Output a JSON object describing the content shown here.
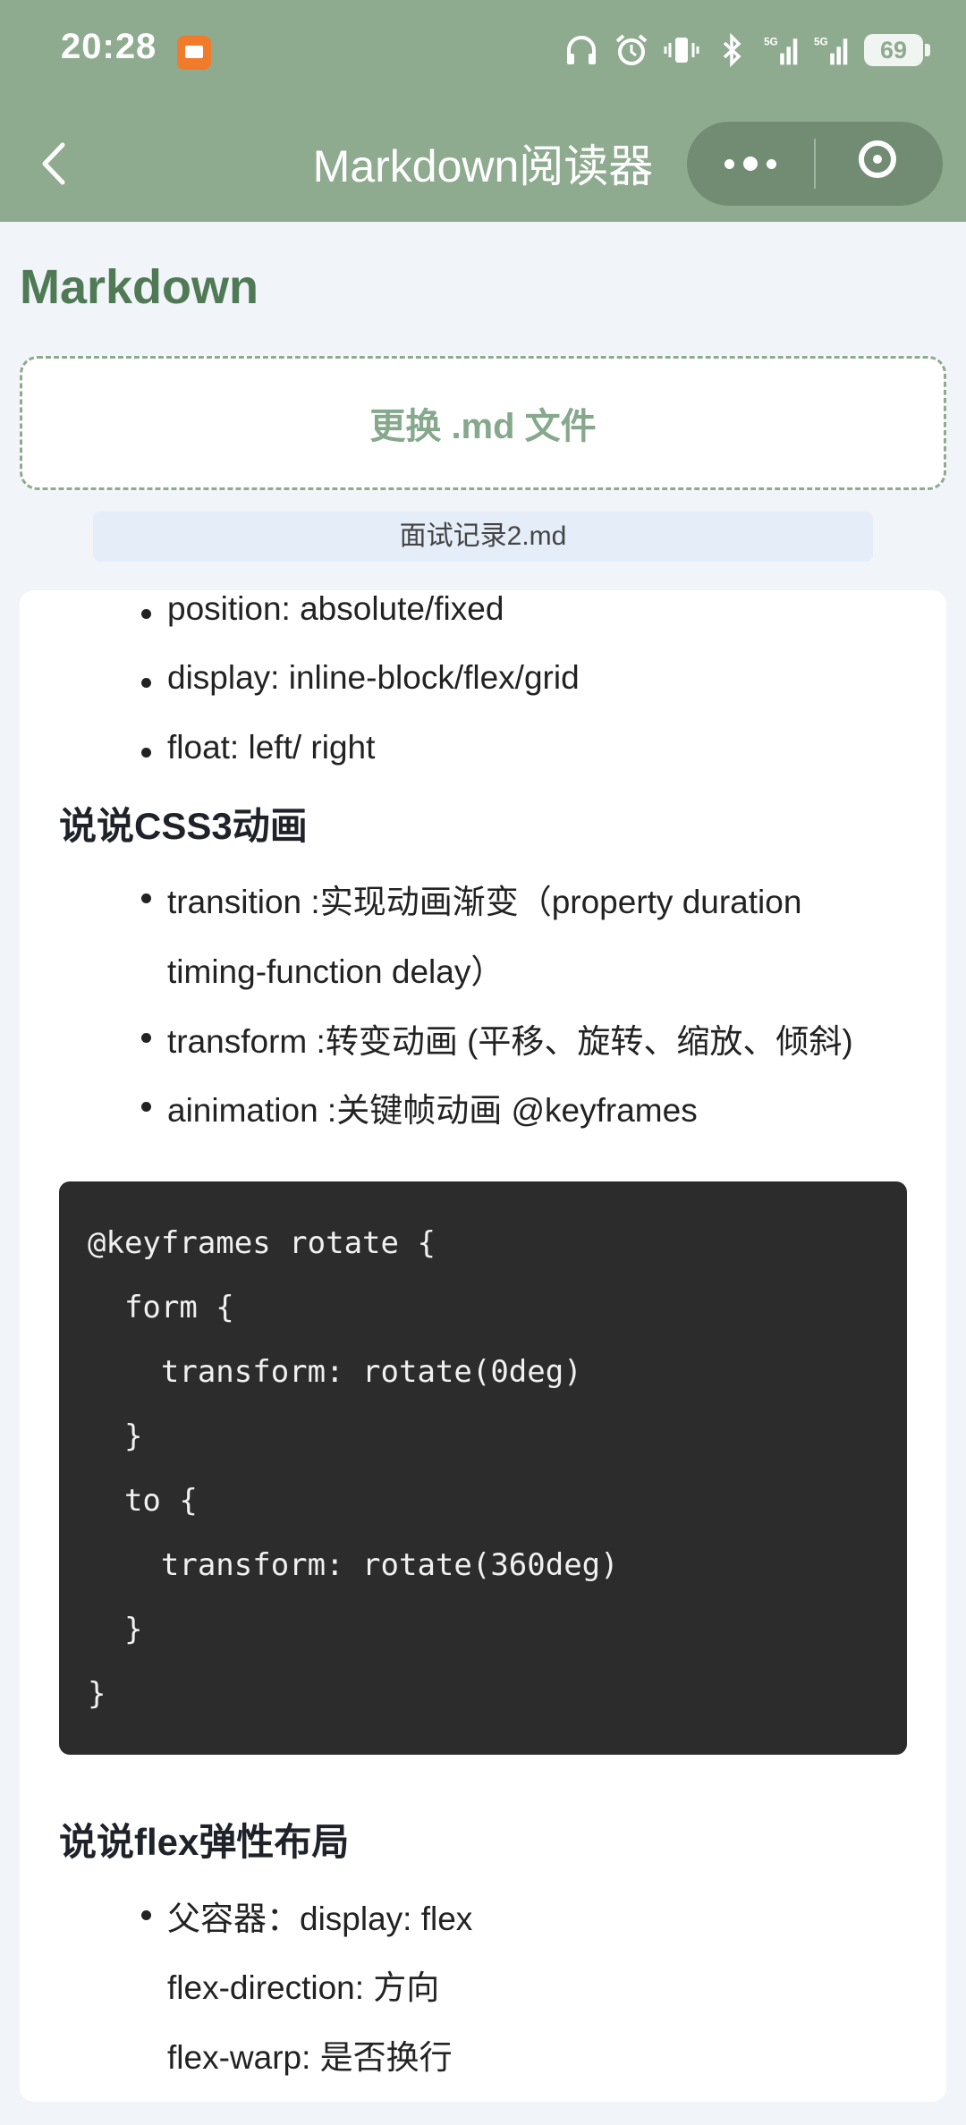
{
  "status_bar": {
    "time": "20:28",
    "battery": "69",
    "icons": [
      "notification-app-icon",
      "headphones-icon",
      "alarm-icon",
      "vibrate-icon",
      "bluetooth-icon",
      "signal-5g-icon",
      "signal-5g-icon"
    ]
  },
  "nav": {
    "title": "Markdown阅读器",
    "back_icon": "chevron-left-icon",
    "more_icon": "more-dots-icon",
    "close_icon": "target-circle-icon"
  },
  "page": {
    "heading": "Markdown",
    "change_button": "更换 .md 文件",
    "file_name": "面试记录2.md"
  },
  "content": {
    "list1": [
      "position: absolute/fixed",
      "display: inline-block/flex/grid",
      "float: left/ right"
    ],
    "h_css3": "说说CSS3动画",
    "list2": [
      "transition :实现动画渐变（property duration",
      "timing-function delay）",
      "transform :转变动画 (平移、旋转、缩放、倾斜)",
      "ainimation :关键帧动画 @keyframes"
    ],
    "code": [
      "@keyframes rotate {",
      "  form {",
      "    transform: rotate(0deg)",
      "  }",
      "  to {",
      "    transform: rotate(360deg)",
      "  }",
      "}"
    ],
    "h_flex": "说说flex弹性布局",
    "list3": [
      "父容器：display: flex",
      "flex-direction: 方向",
      "flex-warp: 是否换行"
    ]
  },
  "colors": {
    "header_bg": "#8eab8f",
    "accent": "#4f7a55",
    "code_bg": "#2c2c2c",
    "page_bg": "#f1f5f9"
  }
}
